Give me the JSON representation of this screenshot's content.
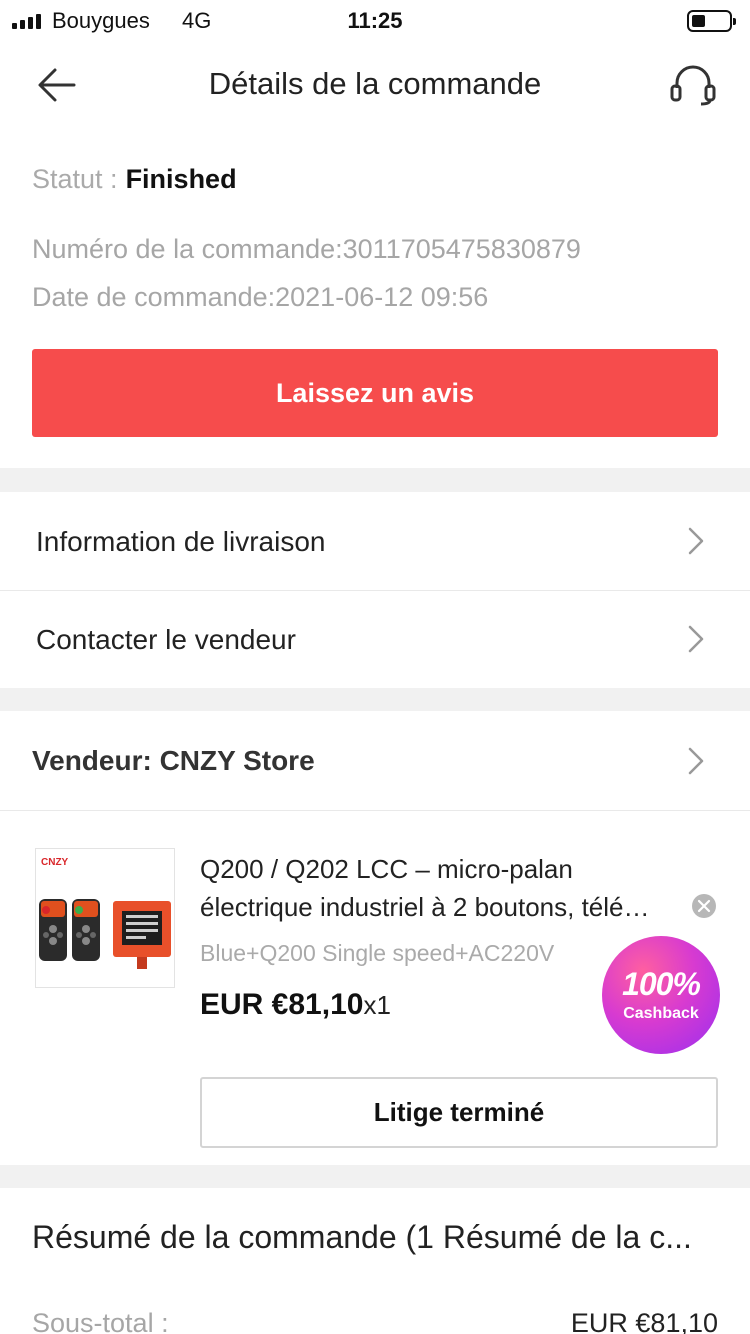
{
  "status_bar": {
    "carrier": "Bouygues",
    "network": "4G",
    "time": "11:25"
  },
  "header": {
    "title": "Détails de la commande",
    "back_icon": "arrow-left-icon",
    "support_icon": "headset-icon"
  },
  "order": {
    "status_label": "Statut :",
    "status_value": "Finished",
    "number": "Numéro de la commande:3011705475830879",
    "date": "Date de commande:2021-06-12 09:56",
    "review_button": "Laissez un avis"
  },
  "menu": {
    "delivery_info": "Information de livraison",
    "contact_seller": "Contacter le vendeur"
  },
  "seller": {
    "label": "Vendeur: CNZY Store"
  },
  "product": {
    "brand_mark": "CNZY",
    "title_line1": "Q200 / Q202 LCC – micro-palan",
    "title_line2": "électrique industriel à 2 boutons, télé…",
    "variant": "Blue+Q200 Single speed+AC220V",
    "price": "EUR €81,10",
    "quantity": "x1",
    "dispute_button": "Litige terminé"
  },
  "cashback": {
    "percent": "100%",
    "label": "Cashback"
  },
  "summary": {
    "title": "Résumé de la commande (1 Résumé de la c...",
    "subtotal_label": "Sous-total :",
    "subtotal_value": "EUR €81,10"
  },
  "colors": {
    "accent": "#f64c4c",
    "section_gap": "#f1f1f1",
    "muted_text": "#a6a6a6"
  }
}
